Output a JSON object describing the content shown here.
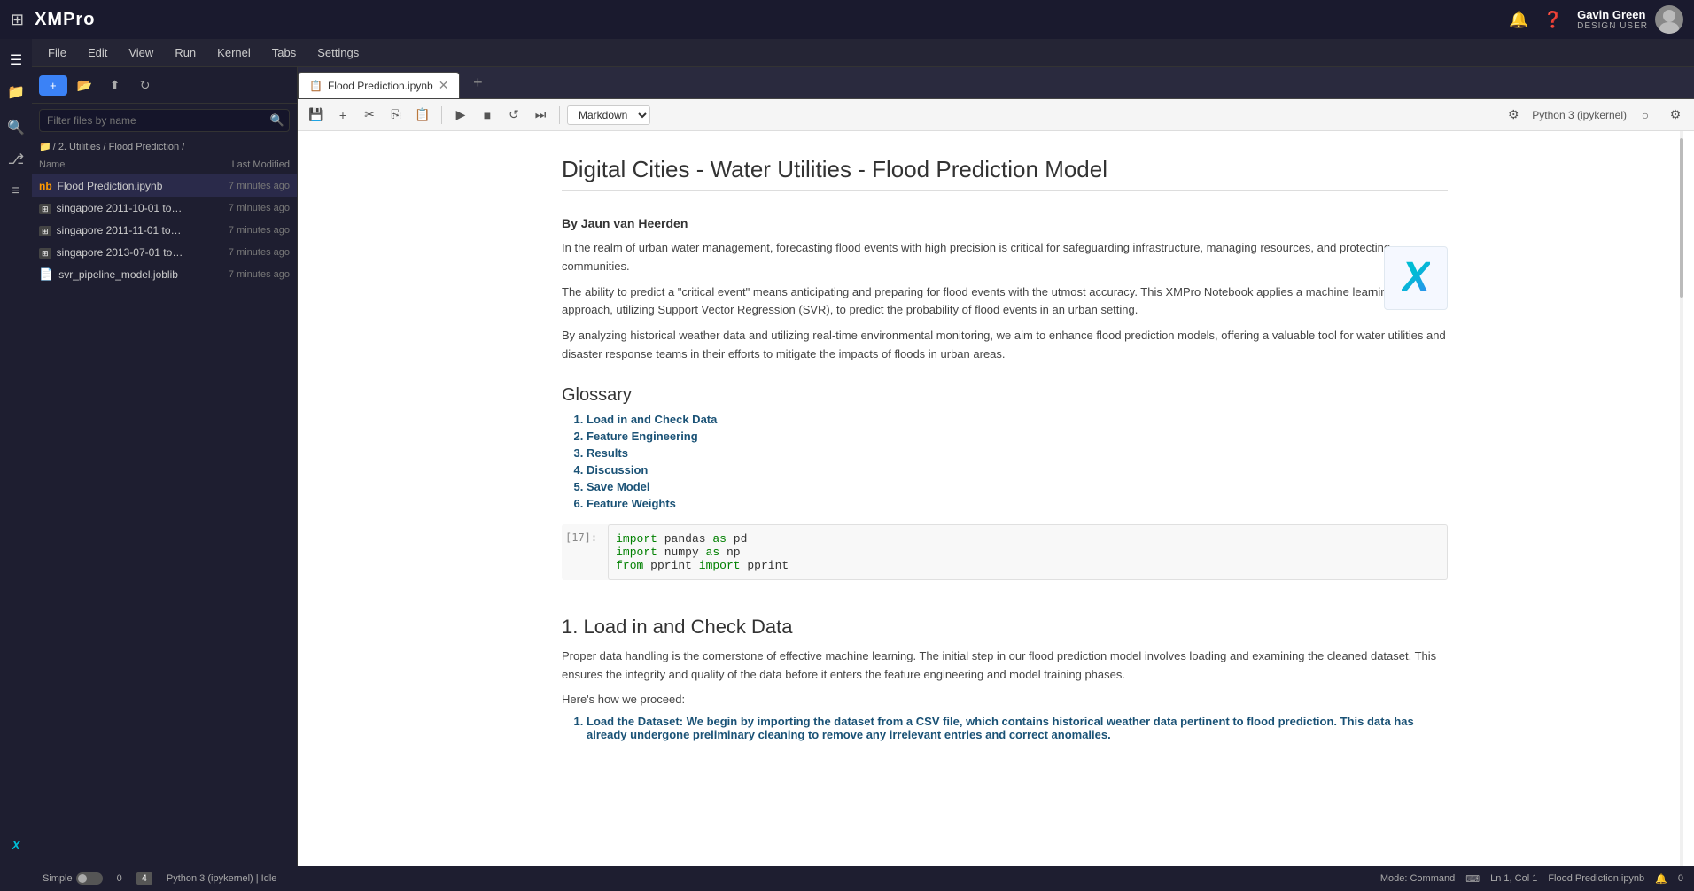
{
  "app": {
    "title": "XMPro"
  },
  "topbar": {
    "logo": "XMPRO",
    "user": {
      "name": "Gavin Green",
      "role": "DESIGN USER"
    },
    "icons": [
      "grid",
      "bell",
      "question",
      "settings"
    ]
  },
  "menubar": {
    "items": [
      "File",
      "Edit",
      "View",
      "Run",
      "Kernel",
      "Tabs",
      "Settings"
    ]
  },
  "file_panel": {
    "toolbar": {
      "new_button": "+",
      "icons": [
        "folder",
        "upload",
        "refresh"
      ]
    },
    "search_placeholder": "Filter files by name",
    "breadcrumb": "/ 2. Utilities / Flood Prediction /",
    "columns": {
      "name": "Name",
      "modified": "Last Modified"
    },
    "files": [
      {
        "name": "Flood Prediction.ipynb",
        "modified": "7 minutes ago",
        "type": "ipynb",
        "active": true
      },
      {
        "name": "singapore 2011-10-01 to 2...",
        "modified": "7 minutes ago",
        "type": "csv"
      },
      {
        "name": "singapore 2011-11-01 to 2...",
        "modified": "7 minutes ago",
        "type": "csv"
      },
      {
        "name": "singapore 2013-07-01 to 2...",
        "modified": "7 minutes ago",
        "type": "csv"
      },
      {
        "name": "svr_pipeline_model.joblib",
        "modified": "7 minutes ago",
        "type": "file"
      }
    ]
  },
  "notebook": {
    "tab_name": "Flood Prediction.ipynb",
    "toolbar": {
      "cell_type": "Markdown",
      "kernel_info": "Python 3 (ipykernel)"
    },
    "content": {
      "title": "Digital Cities - Water Utilities - Flood Prediction Model",
      "author": "By Jaun van Heerden",
      "paragraphs": [
        "In the realm of urban water management, forecasting flood events with high precision is critical for safeguarding infrastructure, managing resources, and protecting communities.",
        "The ability to predict a \"critical event\" means anticipating and preparing for flood events with the utmost accuracy. This XMPro Notebook applies a machine learning approach, utilizing Support Vector Regression (SVR), to predict the probability of flood events in an urban setting.",
        "By analyzing historical weather data and utilizing real-time environmental monitoring, we aim to enhance flood prediction models, offering a valuable tool for water utilities and disaster response teams in their efforts to mitigate the impacts of floods in urban areas."
      ],
      "glossary_title": "Glossary",
      "glossary_items": [
        "Load in and Check Data",
        "Feature Engineering",
        "Results",
        "Discussion",
        "Save Model",
        "Feature Weights"
      ],
      "code_cell": {
        "prompt": "[17]:",
        "lines": [
          "import pandas as pd",
          "import numpy as np",
          "from pprint import pprint"
        ]
      },
      "section1_title": "1. Load in and Check Data",
      "section1_body": "Proper data handling is the cornerstone of effective machine learning. The initial step in our flood prediction model involves loading and examining the cleaned dataset. This ensures the integrity and quality of the data before it enters the feature engineering and model training phases.",
      "section1_proceed": "Here's how we proceed:",
      "section1_list": [
        {
          "label": "Load the Dataset",
          "text": ": We begin by importing the dataset from a CSV file, which contains historical weather data pertinent to flood prediction. This data has already undergone preliminary cleaning to remove any irrelevant entries and correct anomalies."
        }
      ]
    }
  },
  "bottom_bar": {
    "simple_label": "Simple",
    "cell_count": "0",
    "cell_indicator": "4",
    "kernel_status": "Python 3 (ipykernel) | Idle",
    "mode": "Mode: Command",
    "cursor": "Ln 1, Col 1",
    "file": "Flood Prediction.ipynb",
    "bell": "0"
  }
}
